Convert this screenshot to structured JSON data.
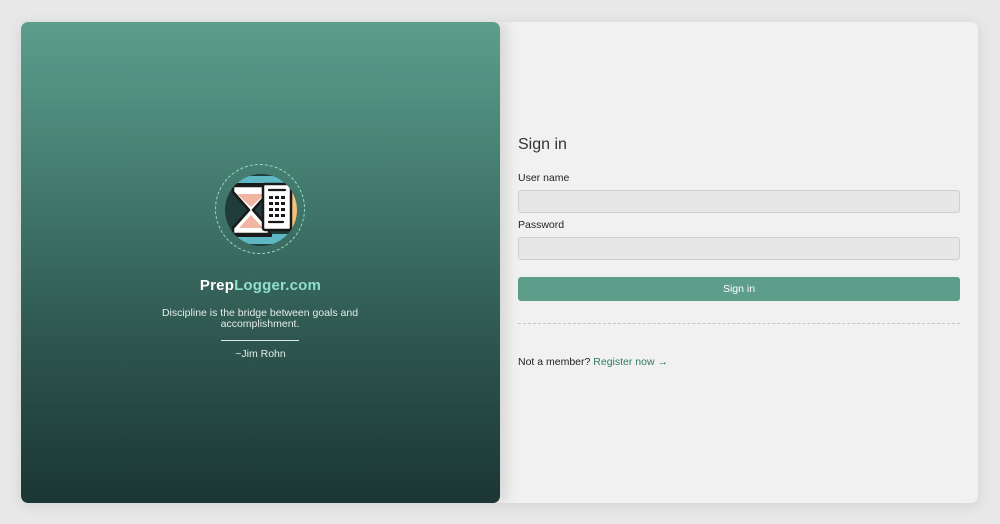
{
  "branding": {
    "name_part1": "Prep",
    "name_part2": "Logger.com",
    "quote": "Discipline is the bridge between goals and accomplishment.",
    "author": "~Jim Rohn",
    "logo_icon": "hourglass-notepad-icon"
  },
  "signin": {
    "title": "Sign in",
    "username_label": "User name",
    "username_value": "",
    "password_label": "Password",
    "password_value": "",
    "submit_label": "Sign in",
    "not_member_text": "Not a member?",
    "register_link": "Register now →"
  },
  "colors": {
    "accent": "#5d9e8b",
    "brand_highlight": "#8fe0cb",
    "link": "#2f7a5e",
    "panel_top": "#5b9e8c",
    "panel_bottom": "#1b3634"
  }
}
